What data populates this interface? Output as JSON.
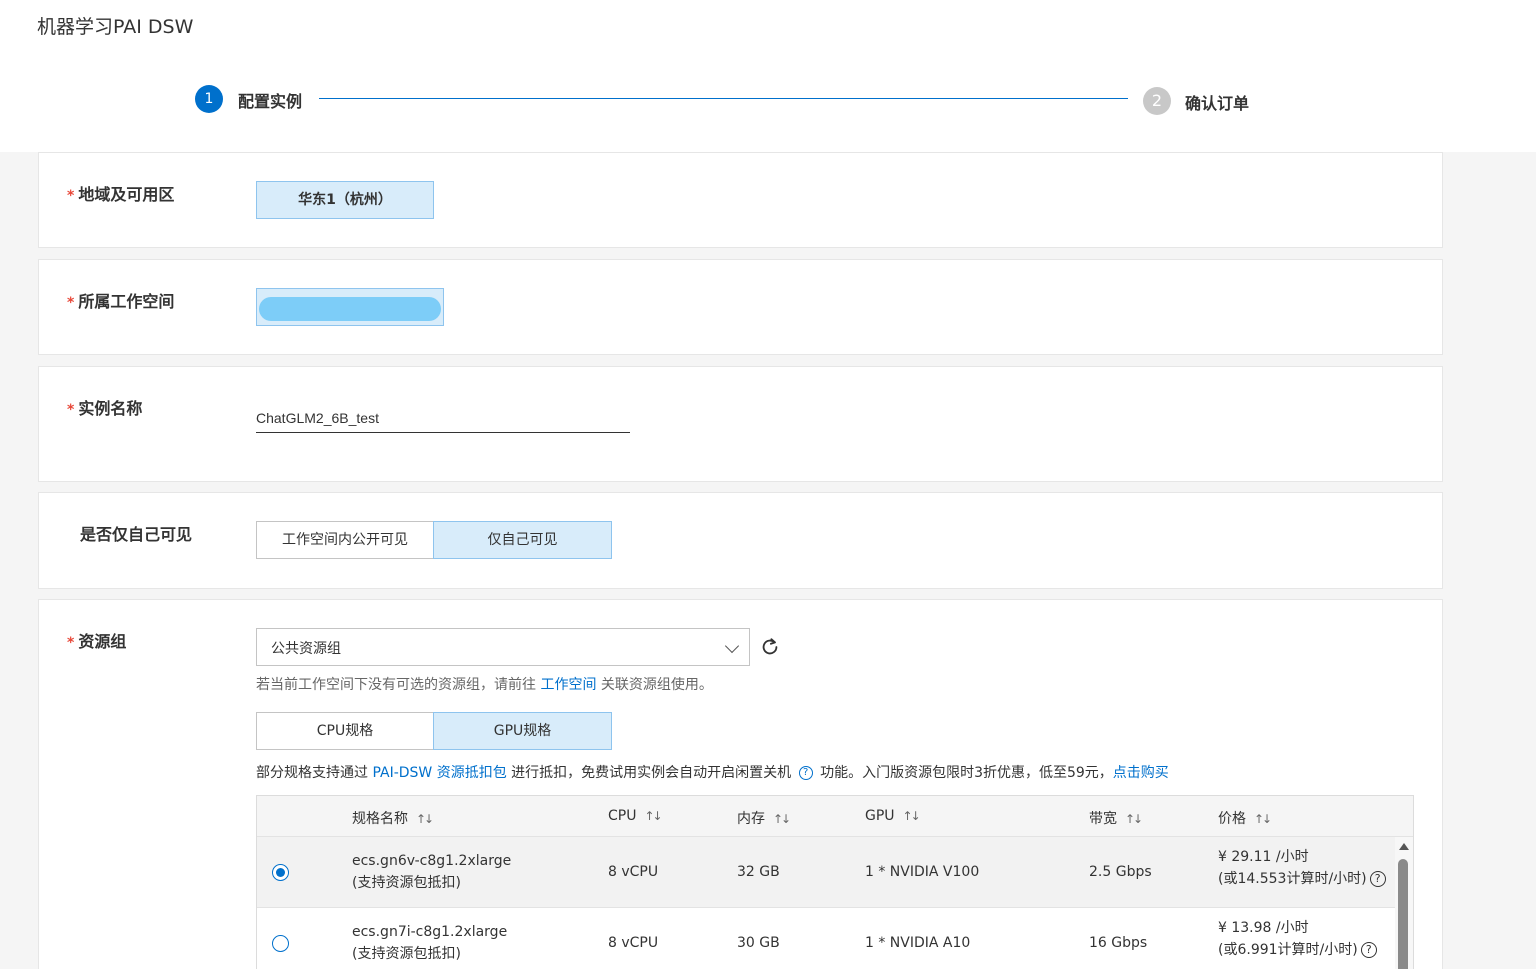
{
  "app": {
    "title": "机器学习PAI DSW"
  },
  "steps": [
    {
      "num": "1",
      "label": "配置实例"
    },
    {
      "num": "2",
      "label": "确认订单"
    }
  ],
  "region": {
    "label": "地域及可用区",
    "value": "华东1（杭州）"
  },
  "workspace": {
    "label": "所属工作空间"
  },
  "instance": {
    "label": "实例名称",
    "value": "ChatGLM2_6B_test"
  },
  "visibility": {
    "label": "是否仅自己可见",
    "options": [
      "工作空间内公开可见",
      "仅自己可见"
    ],
    "selected": "仅自己可见"
  },
  "resource": {
    "label": "资源组",
    "select_value": "公共资源组",
    "hint_before": "若当前工作空间下没有可选的资源组，请前往 ",
    "hint_link": "工作空间",
    "hint_after": " 关联资源组使用。",
    "spec_tabs": [
      "CPU规格",
      "GPU规格"
    ],
    "spec_selected": "GPU规格",
    "promo_before": "部分规格支持通过 ",
    "promo_link": "PAI-DSW 资源抵扣包",
    "promo_mid": " 进行抵扣，免费试用实例会自动开启闲置关机 ",
    "promo_after": " 功能。入门版资源包限时3折优惠，低至59元，",
    "promo_buy": "点击购买"
  },
  "table": {
    "headers": [
      "规格名称",
      "CPU",
      "内存",
      "GPU",
      "带宽",
      "价格"
    ],
    "rows": [
      {
        "name": "ecs.gn6v-c8g1.2xlarge",
        "note": "(支持资源包抵扣)",
        "cpu": "8 vCPU",
        "mem": "32 GB",
        "gpu": "1 * NVIDIA V100",
        "bw": "2.5 Gbps",
        "price": "¥ 29.11 /小时",
        "price2": "(或14.553计算时/小时)",
        "selected": true
      },
      {
        "name": "ecs.gn7i-c8g1.2xlarge",
        "note": "(支持资源包抵扣)",
        "cpu": "8 vCPU",
        "mem": "30 GB",
        "gpu": "1 * NVIDIA A10",
        "bw": "16 Gbps",
        "price": "¥ 13.98 /小时",
        "price2": "(或6.991计算时/小时)",
        "selected": false
      }
    ]
  },
  "colors": {
    "accent": "#0070cc",
    "selected_bg": "#d8ecfa",
    "required": "#e84738"
  }
}
